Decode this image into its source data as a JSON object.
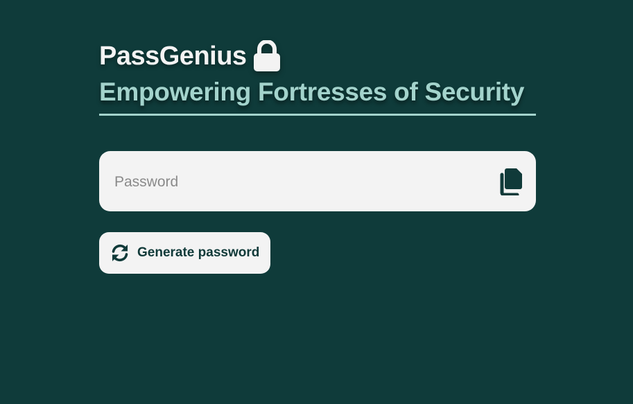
{
  "header": {
    "brand_name": "PassGenius",
    "tagline": "Empowering Fortresses of Security"
  },
  "password": {
    "placeholder": "Password",
    "value": ""
  },
  "actions": {
    "generate_label": "Generate password"
  },
  "icons": {
    "brand": "lock-icon",
    "copy": "copy-icon",
    "generate": "refresh-icon"
  },
  "colors": {
    "background": "#0f3b3a",
    "accent": "#a3d3cc",
    "surface": "#f3f3f3",
    "text_dark": "#103a39"
  }
}
